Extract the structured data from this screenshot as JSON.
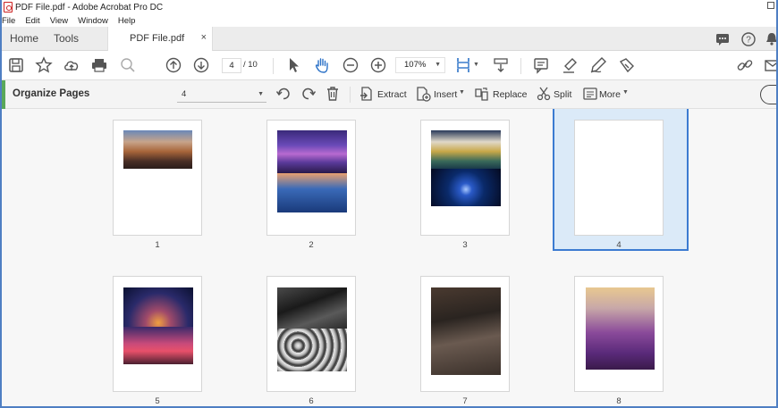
{
  "window": {
    "title": "PDF File.pdf - Adobe Acrobat Pro DC",
    "menu": [
      "File",
      "Edit",
      "View",
      "Window",
      "Help"
    ]
  },
  "tabs": {
    "home": "Home",
    "tools": "Tools",
    "document": "PDF File.pdf",
    "close": "×"
  },
  "toolbar": {
    "current_page": "4",
    "total_pages": "/ 10",
    "zoom": "107%"
  },
  "organize": {
    "title": "Organize Pages",
    "page_selector": "4",
    "extract": "Extract",
    "insert": "Insert",
    "replace": "Replace",
    "split": "Split",
    "more": "More"
  },
  "pages": [
    {
      "label": "1",
      "selected": false
    },
    {
      "label": "2",
      "selected": false
    },
    {
      "label": "3",
      "selected": false
    },
    {
      "label": "4",
      "selected": true
    },
    {
      "label": "5",
      "selected": false
    },
    {
      "label": "6",
      "selected": false
    },
    {
      "label": "7",
      "selected": false
    },
    {
      "label": "8",
      "selected": false
    }
  ],
  "colors": {
    "accent_blue": "#3c7bd1",
    "selection_fill": "#dbeaf8",
    "organize_accent": "#5aa85a"
  }
}
